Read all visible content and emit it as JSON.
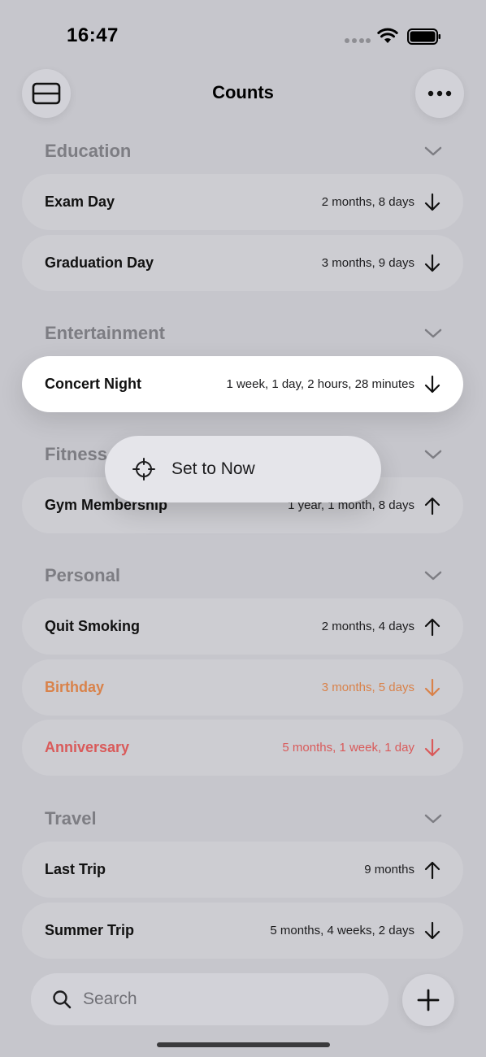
{
  "status_bar": {
    "time": "16:47"
  },
  "header": {
    "title": "Counts"
  },
  "sections": [
    {
      "title": "Education",
      "items": [
        {
          "name": "Exam Day",
          "count": "2 months, 8 days",
          "direction": "down"
        },
        {
          "name": "Graduation Day",
          "count": "3 months, 9 days",
          "direction": "down"
        }
      ]
    },
    {
      "title": "Entertainment",
      "items": [
        {
          "name": "Concert Night",
          "count": "1 week, 1 day, 2 hours, 28 minutes",
          "direction": "down"
        }
      ]
    },
    {
      "title": "Fitness",
      "items": [
        {
          "name": "Gym Membership",
          "count": "1 year, 1 month, 8 days",
          "direction": "up"
        }
      ]
    },
    {
      "title": "Personal",
      "items": [
        {
          "name": "Quit Smoking",
          "count": "2 months, 4 days",
          "direction": "up"
        },
        {
          "name": "Birthday",
          "count": "3 months, 5 days",
          "direction": "down",
          "color": "#d9824a"
        },
        {
          "name": "Anniversary",
          "count": "5 months, 1 week, 1 day",
          "direction": "down",
          "color": "#d95a5a"
        }
      ]
    },
    {
      "title": "Travel",
      "items": [
        {
          "name": "Last Trip",
          "count": "9 months",
          "direction": "up"
        },
        {
          "name": "Summer Trip",
          "count": "5 months, 4 weeks, 2 days",
          "direction": "down"
        }
      ]
    }
  ],
  "context_menu": {
    "item_label": "Set to Now",
    "icon": "crosshair-icon"
  },
  "search": {
    "placeholder": "Search"
  },
  "icons": {
    "layout": "layout-icon",
    "more": "more-icon",
    "add": "plus-icon",
    "search": "search-icon",
    "chevron": "chevron-down-icon",
    "arrow_up": "arrow-up-icon",
    "arrow_down": "arrow-down-icon"
  }
}
